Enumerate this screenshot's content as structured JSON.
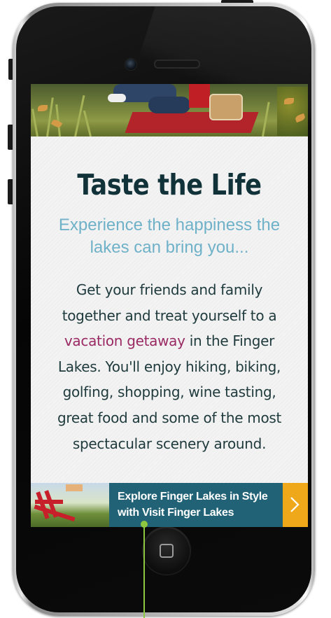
{
  "headline": "Taste the Life",
  "subheadline": "Experience the happiness the lakes can bring you...",
  "body": {
    "before_link": "Get your friends and family together and treat yourself to a",
    "link_text": "vacation getaway",
    "after_link": "in the Finger Lakes. You'll enjoy hiking, biking, golfing, shopping, wine tasting, great food and some of the most spectacular scenery around."
  },
  "promo": {
    "line1": "Explore Finger Lakes in Style",
    "line2": "with Visit Finger Lakes",
    "arrow_icon": "chevron-right-icon"
  },
  "colors": {
    "headline": "#103238",
    "subheadline": "#6fb1c9",
    "link": "#9a2a63",
    "promo_panel": "#226276",
    "promo_arrow": "#f0a81b",
    "connector": "#8dc63f"
  }
}
